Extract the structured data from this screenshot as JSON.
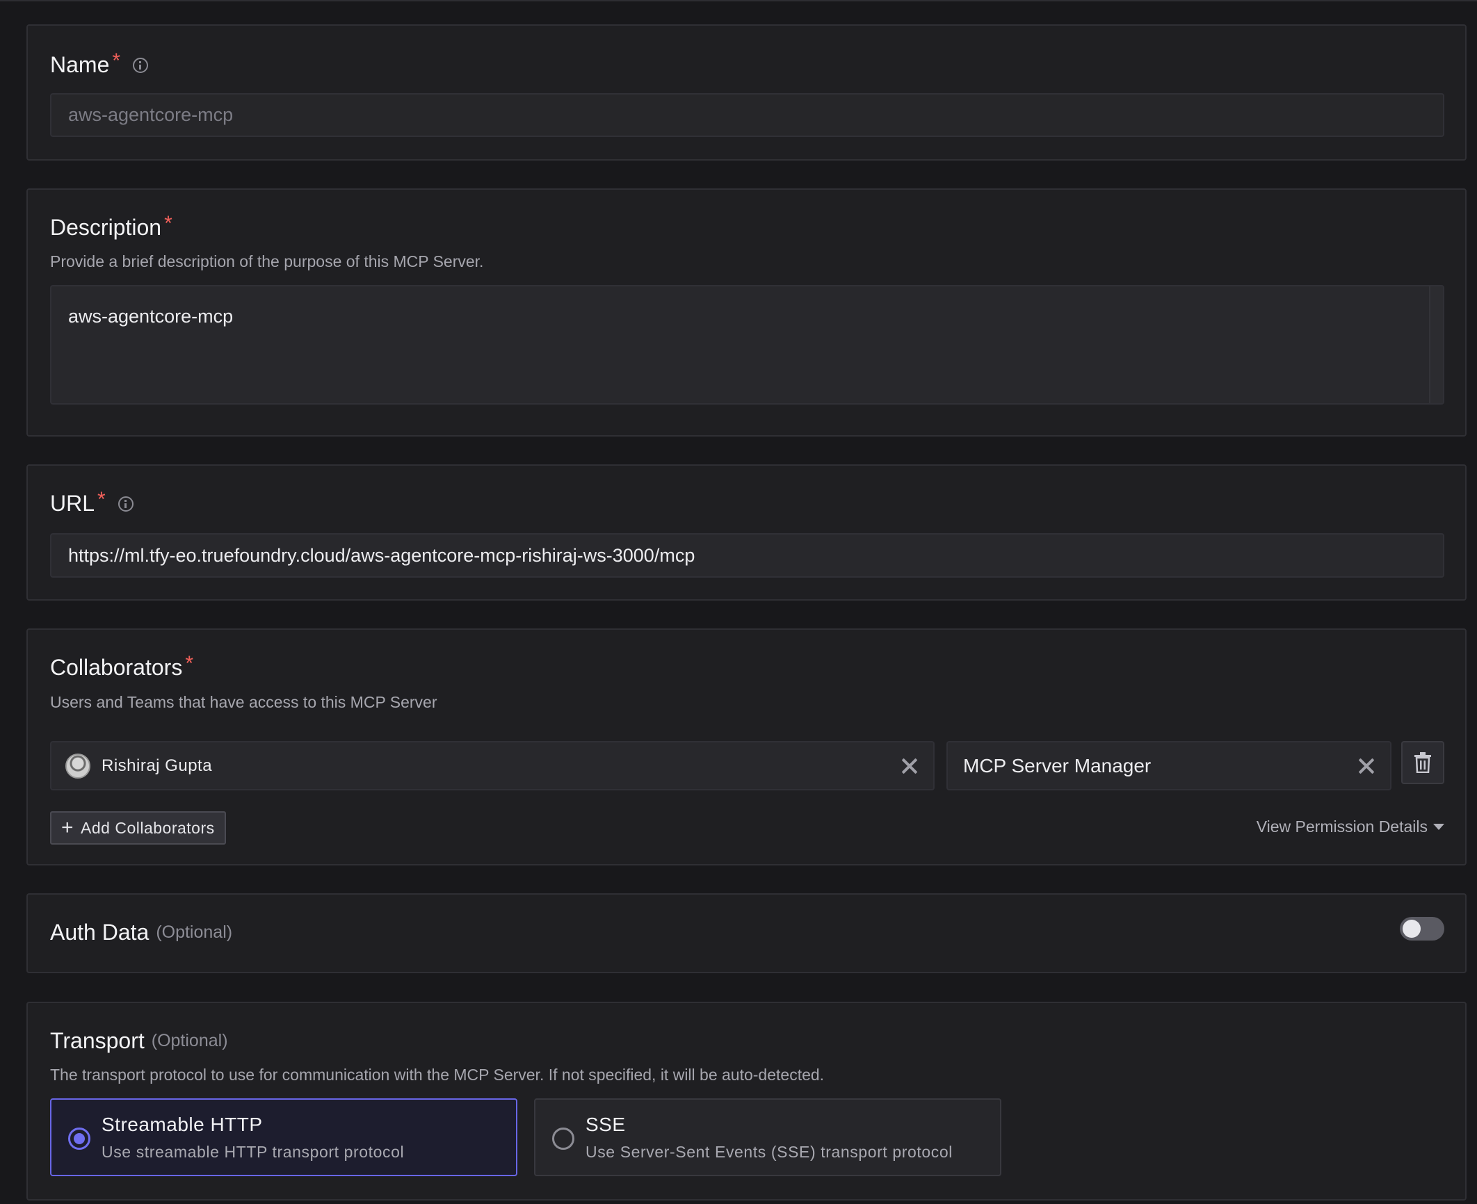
{
  "name_section": {
    "label": "Name",
    "required_mark": "*",
    "value": "aws-agentcore-mcp"
  },
  "description_section": {
    "label": "Description",
    "required_mark": "*",
    "help": "Provide a brief description of the purpose of this MCP Server.",
    "value": "aws-agentcore-mcp"
  },
  "url_section": {
    "label": "URL",
    "required_mark": "*",
    "value": "https://ml.tfy-eo.truefoundry.cloud/aws-agentcore-mcp-rishiraj-ws-3000/mcp"
  },
  "collaborators_section": {
    "label": "Collaborators",
    "required_mark": "*",
    "help": "Users and Teams that have access to this MCP Server",
    "collaborator": {
      "name": "Rishiraj Gupta",
      "role": "MCP Server Manager"
    },
    "add_button": "Add Collaborators",
    "add_icon": "+",
    "permission_link": "View Permission Details"
  },
  "auth_section": {
    "label": "Auth Data",
    "optional": "(Optional)",
    "enabled": false
  },
  "transport_section": {
    "label": "Transport",
    "optional": "(Optional)",
    "help": "The transport protocol to use for communication with the MCP Server. If not specified, it will be auto-detected.",
    "options": [
      {
        "title": "Streamable HTTP",
        "description": "Use streamable HTTP transport protocol",
        "selected": true
      },
      {
        "title": "SSE",
        "description": "Use Server-Sent Events (SSE) transport protocol",
        "selected": false
      }
    ]
  },
  "colors": {
    "background": "#18181b",
    "panel": "#1f1f22",
    "required": "#f0605a",
    "accent": "#6f6ef0"
  }
}
